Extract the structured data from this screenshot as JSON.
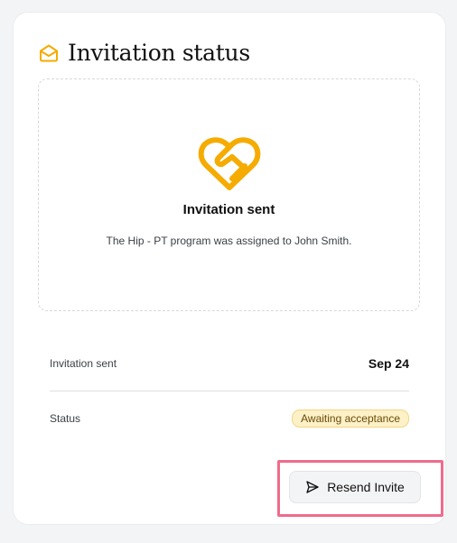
{
  "header": {
    "title": "Invitation status",
    "icon": "envelope-open-icon",
    "accent_color": "#f5ab00"
  },
  "panel": {
    "icon": "heart-handshake-icon",
    "title": "Invitation sent",
    "description": "The Hip - PT program was assigned to John Smith."
  },
  "details": {
    "rows": [
      {
        "label": "Invitation sent",
        "value": "Sep 24"
      },
      {
        "label": "Status",
        "value": "Awaiting acceptance"
      }
    ]
  },
  "actions": {
    "resend_label": "Resend Invite",
    "resend_icon": "send-icon"
  }
}
